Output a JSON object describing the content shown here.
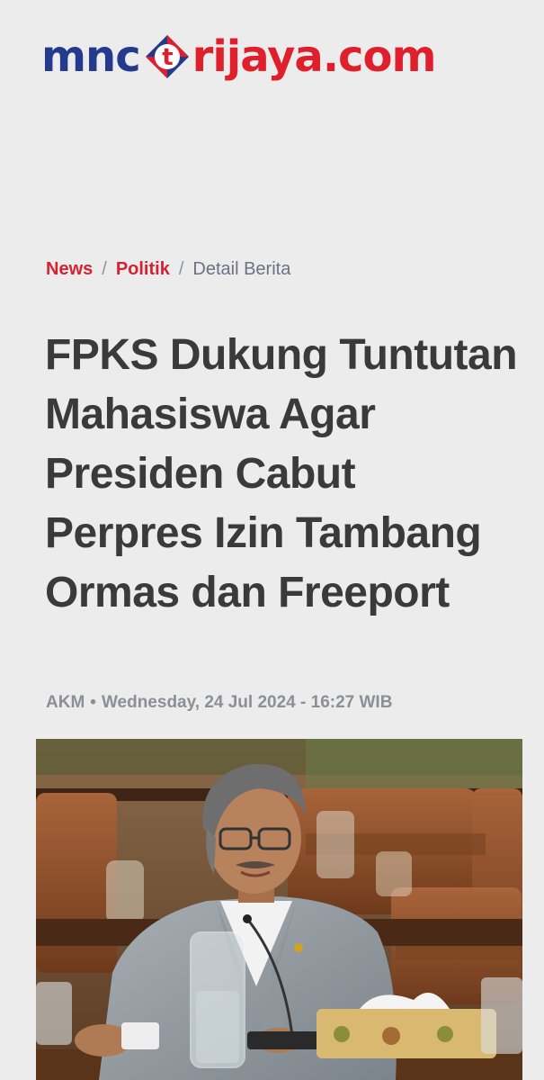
{
  "logo": {
    "part1": "mnc",
    "mark_letter": "t",
    "part2": "rijaya",
    "part3": ".com",
    "colors": {
      "blue": "#243a8c",
      "red": "#e01f2d"
    }
  },
  "breadcrumb": {
    "items": [
      {
        "label": "News"
      },
      {
        "label": "Politik"
      }
    ],
    "separator": "/",
    "current": "Detail Berita"
  },
  "article": {
    "title": "FPKS Dukung Tuntutan Mahasiswa Agar Presiden Cabut Perpres Izin Tambang Ormas dan Freeport",
    "author": "AKM",
    "meta_separator": "•",
    "date": "Wednesday, 24 Jul 2024 - 16:27 WIB"
  },
  "colors": {
    "background": "#ececec",
    "accent_red": "#d42231",
    "headline": "#3a3a3a",
    "meta": "#8a8f98"
  },
  "image": {
    "icon": "news-photo"
  }
}
